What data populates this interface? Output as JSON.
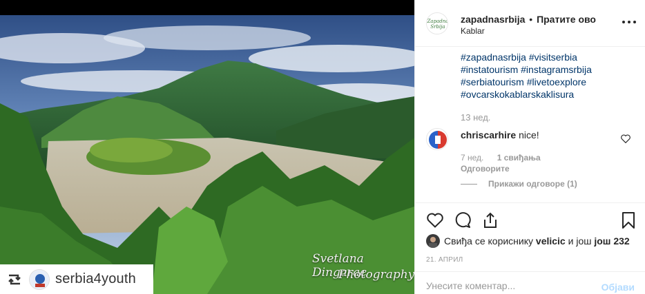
{
  "post": {
    "photo_alt": "Lake with wooded island and mountain",
    "watermark": [
      "Svetlana Dingarac",
      "Photography"
    ],
    "repost": {
      "username": "serbia4youth"
    }
  },
  "header": {
    "username": "zapadnasrbija",
    "separator": "•",
    "follow_label": "Пратите ово",
    "location": "Kablar",
    "more_icon": "more-horizontal-icon"
  },
  "caption": {
    "hashtags": [
      "#zapadnasrbija #visitserbia",
      "#instatourism #instagramsrbija",
      "#serbiatourism #livetoexplore",
      "#ovcarskokablarskaklisura"
    ],
    "time": "13 нед."
  },
  "comment": {
    "username": "chriscarhire",
    "text": "nice!",
    "time": "7 нед.",
    "likes": "1 свиђања",
    "reply_label": "Одговорите",
    "view_replies_label": "Прикажи одговоре (1)"
  },
  "actions": {
    "like_icon": "heart-icon",
    "comment_icon": "comment-icon",
    "share_icon": "share-icon",
    "save_icon": "bookmark-icon"
  },
  "likes_line": {
    "prefix": "Свиђа се кориснику",
    "user": "velicic",
    "middle": "и још",
    "count": "још 232"
  },
  "date": "21. АПРИЛ",
  "add_comment": {
    "placeholder": "Унесите коментар...",
    "post_label": "Објави"
  },
  "colors": {
    "link": "#003569",
    "muted": "#999999",
    "border": "#efefef",
    "post_disabled": "#b3dbff"
  }
}
